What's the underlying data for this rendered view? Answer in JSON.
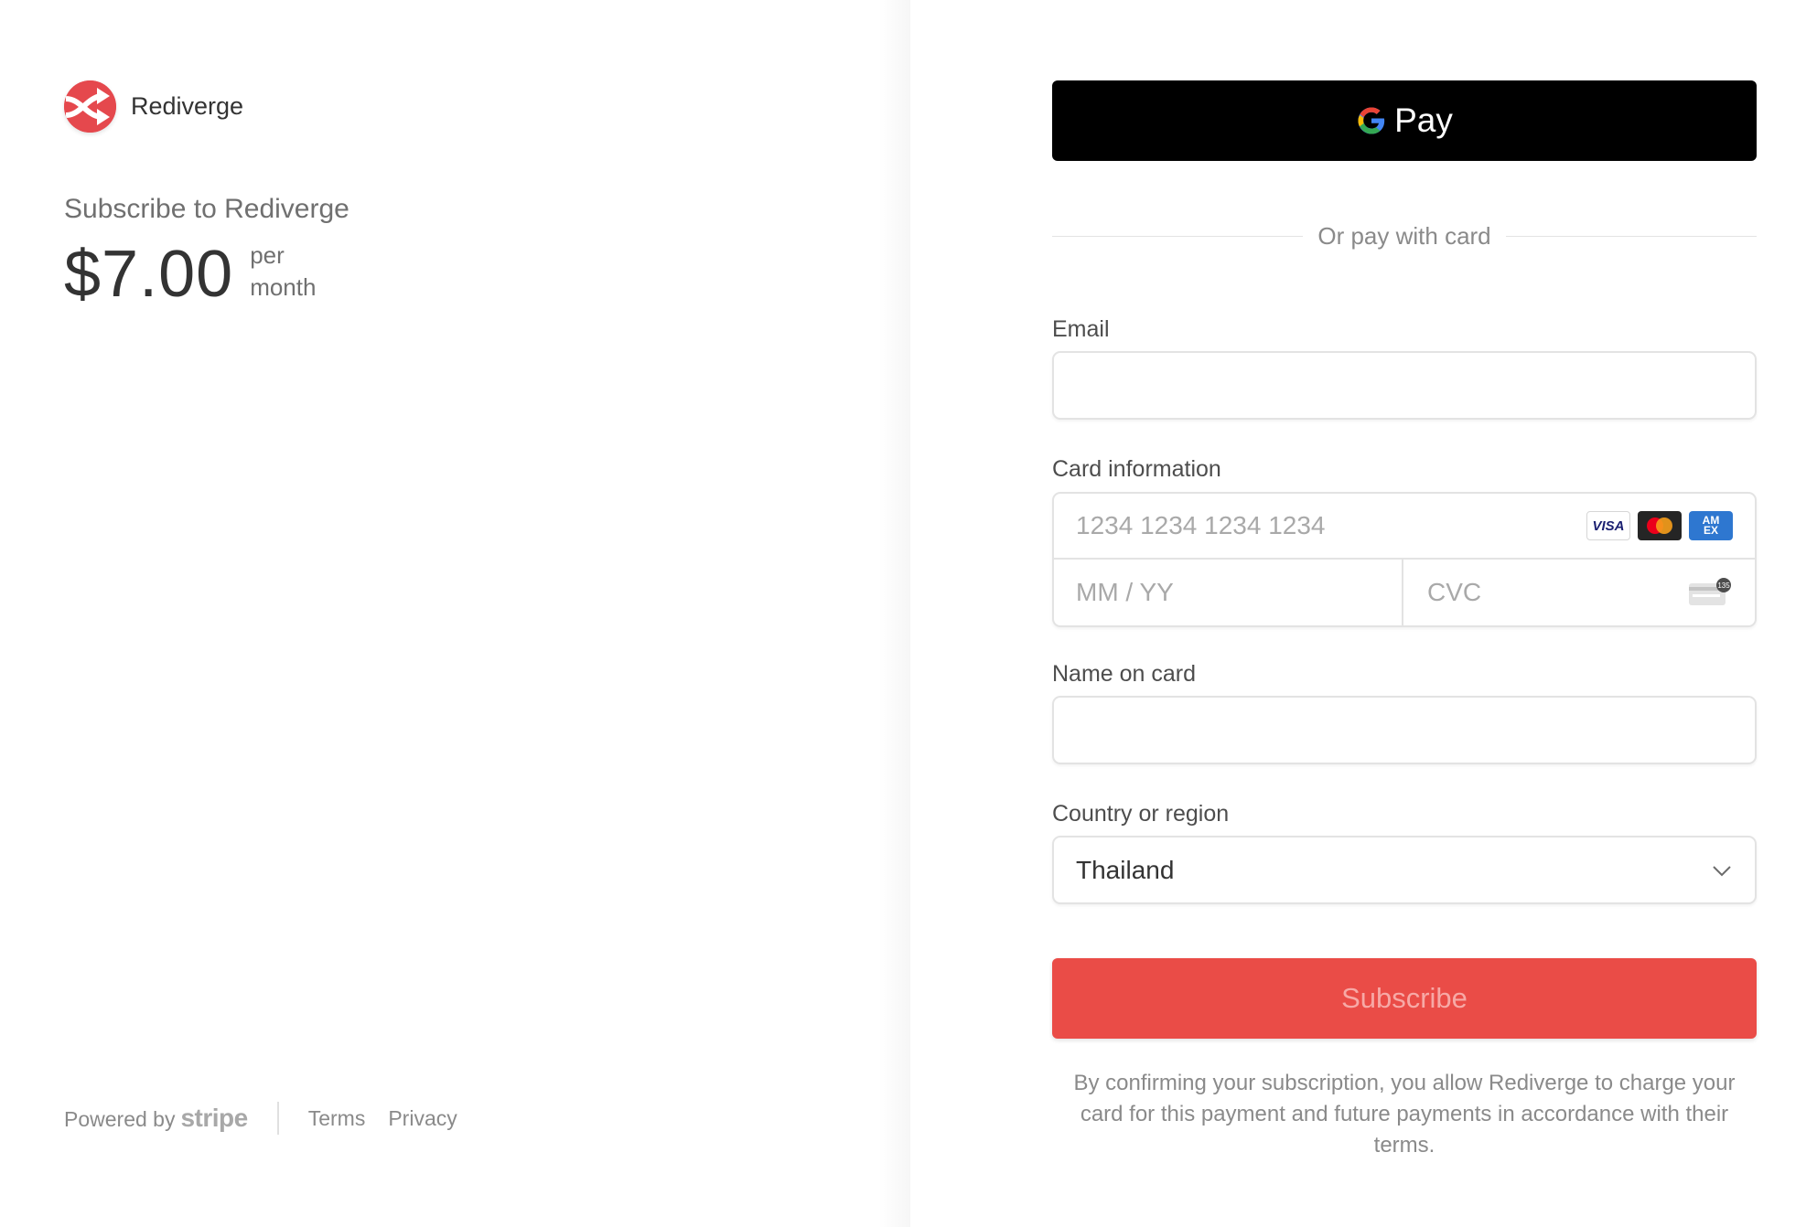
{
  "merchant": {
    "name": "Rediverge",
    "logo_icon": "shuffle-arrows-icon",
    "brand_color": "#e5484d"
  },
  "summary": {
    "title": "Subscribe to Rediverge",
    "price": "$7.00",
    "period_line1": "per",
    "period_line2": "month"
  },
  "footer": {
    "powered_by": "Powered by",
    "stripe": "stripe",
    "links": [
      "Terms",
      "Privacy"
    ]
  },
  "payment": {
    "gpay_label": "Pay",
    "divider_text": "Or pay with card",
    "email": {
      "label": "Email",
      "value": "",
      "placeholder": ""
    },
    "card": {
      "label": "Card information",
      "number_placeholder": "1234 1234 1234 1234",
      "expiry_placeholder": "MM / YY",
      "cvc_placeholder": "CVC",
      "brands": [
        "VISA",
        "Mastercard",
        "AMEX"
      ],
      "cvc_hint": "135"
    },
    "name": {
      "label": "Name on card",
      "value": "",
      "placeholder": ""
    },
    "country": {
      "label": "Country or region",
      "selected": "Thailand"
    },
    "subscribe_label": "Subscribe",
    "subscribe_color": "#ea4c47",
    "legal": "By confirming your subscription, you allow Rediverge to charge your card for this payment and future payments in accordance with their terms."
  }
}
